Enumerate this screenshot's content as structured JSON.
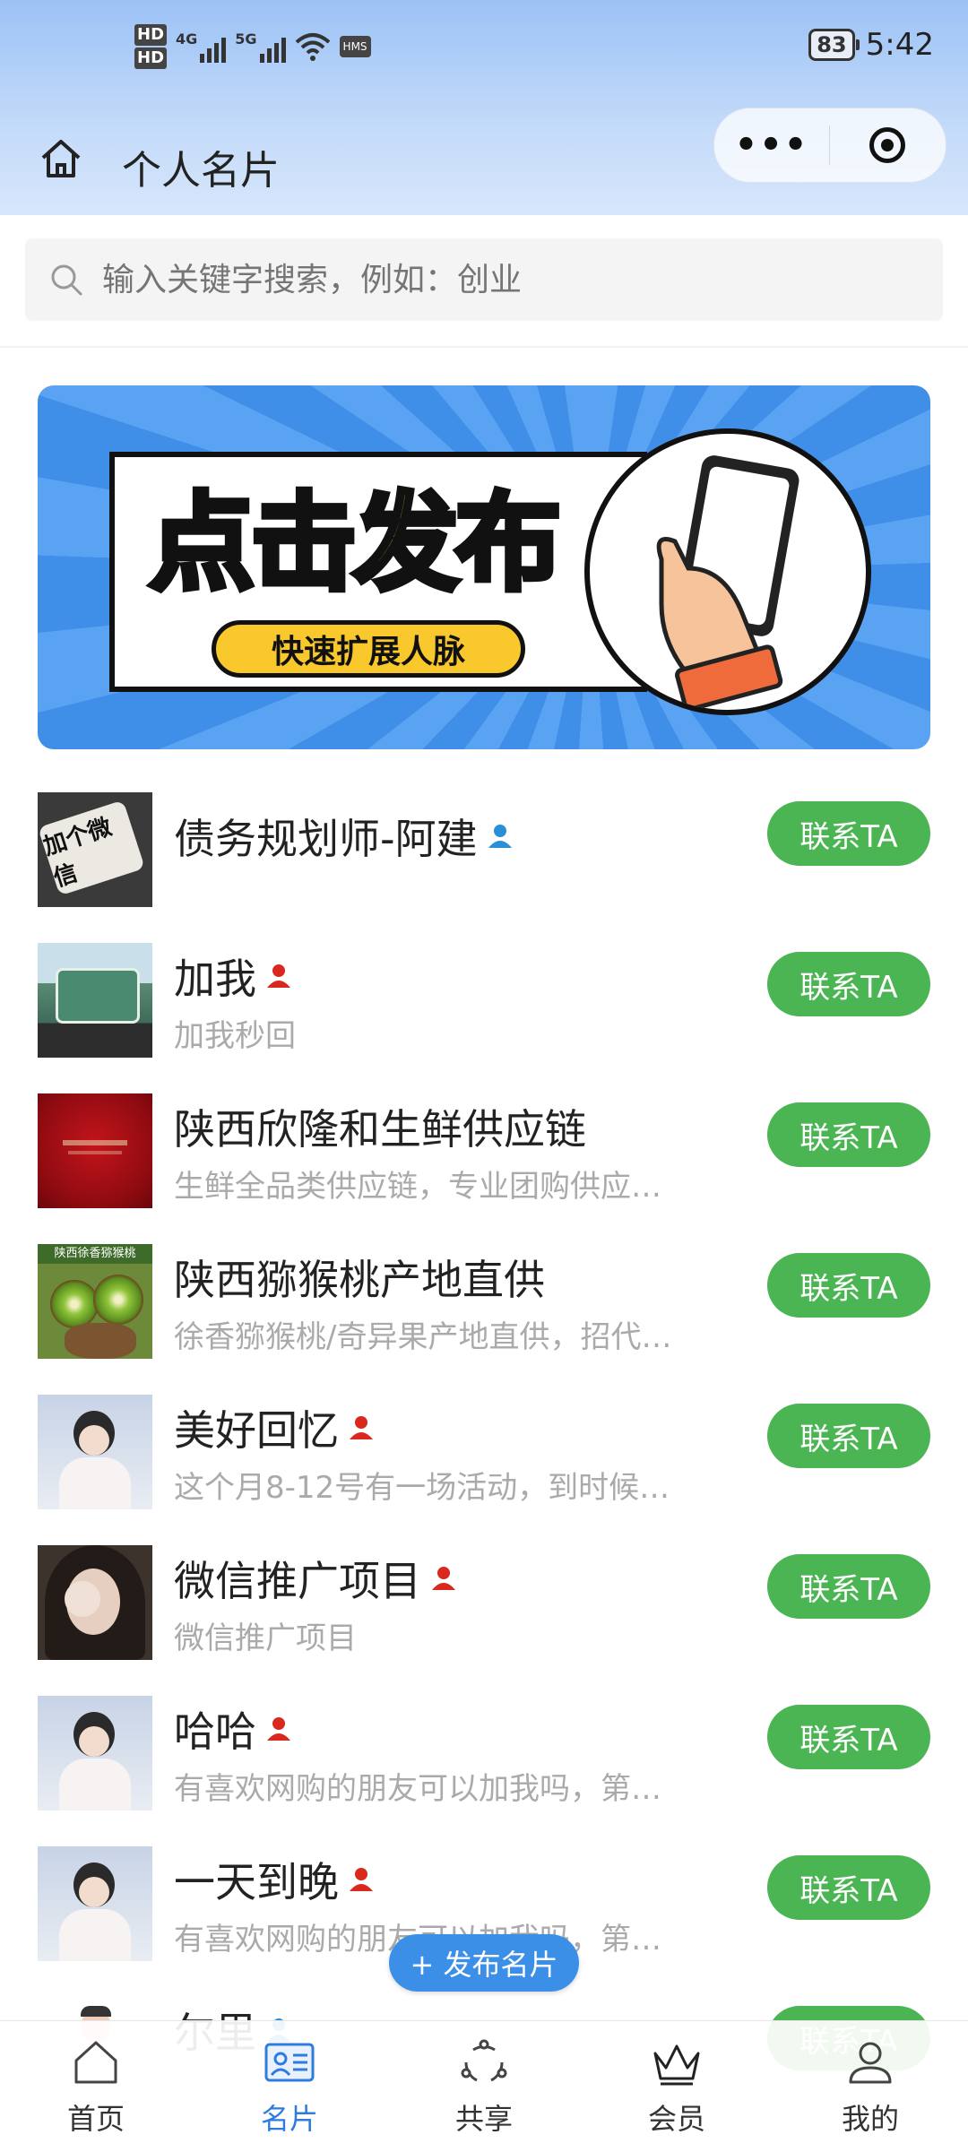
{
  "status_bar": {
    "hd1": "HD",
    "hd2": "HD",
    "net1": "4G",
    "net2": "5G",
    "hms": "HMS",
    "battery": "83",
    "time": "5:42"
  },
  "header": {
    "title": "个人名片",
    "more_label": "•••"
  },
  "search": {
    "placeholder": "输入关键字搜索，例如：创业"
  },
  "banner": {
    "title": "点击发布",
    "subtitle": "快速扩展人脉"
  },
  "contacts": [
    {
      "name": "债务规划师-阿建",
      "desc": "",
      "badge_color": "#2a8fd6",
      "button": "联系TA",
      "avatar_text": "加个微信"
    },
    {
      "name": "加我",
      "desc": "加我秒回",
      "badge_color": "#d9281e",
      "button": "联系TA"
    },
    {
      "name": "陕西欣隆和生鲜供应链",
      "desc": "生鲜全品类供应链，专业团购供应…",
      "badge_color": "",
      "button": "联系TA"
    },
    {
      "name": "陕西猕猴桃产地直供",
      "desc": "徐香猕猴桃/奇异果产地直供，招代…",
      "badge_color": "",
      "button": "联系TA",
      "avatar_text": "陕西徐香猕猴桃"
    },
    {
      "name": "美好回忆",
      "desc": "这个月8-12号有一场活动，到时候…",
      "badge_color": "#d9281e",
      "button": "联系TA"
    },
    {
      "name": "微信推广项目",
      "desc": "微信推广项目",
      "badge_color": "#d9281e",
      "button": "联系TA"
    },
    {
      "name": "哈哈",
      "desc": "有喜欢网购的朋友可以加我吗，第…",
      "badge_color": "#d9281e",
      "button": "联系TA"
    },
    {
      "name": "一天到晚",
      "desc": "有喜欢网购的朋友可以加我吗，第…",
      "badge_color": "#d9281e",
      "button": "联系TA"
    },
    {
      "name": "尔里",
      "desc": "",
      "badge_color": "#2a8fd6",
      "button": "联系TA"
    }
  ],
  "fab": {
    "label": "+ 发布名片"
  },
  "tabbar": [
    {
      "label": "首页",
      "icon": "home-icon"
    },
    {
      "label": "名片",
      "icon": "card-icon",
      "active": true
    },
    {
      "label": "共享",
      "icon": "share-icon"
    },
    {
      "label": "会员",
      "icon": "crown-icon"
    },
    {
      "label": "我的",
      "icon": "user-icon"
    }
  ],
  "colors": {
    "accent_green": "#4cb553",
    "accent_blue": "#2e7ce0",
    "banner_blue": "#4a97ee",
    "banner_yellow": "#f9c82d"
  }
}
